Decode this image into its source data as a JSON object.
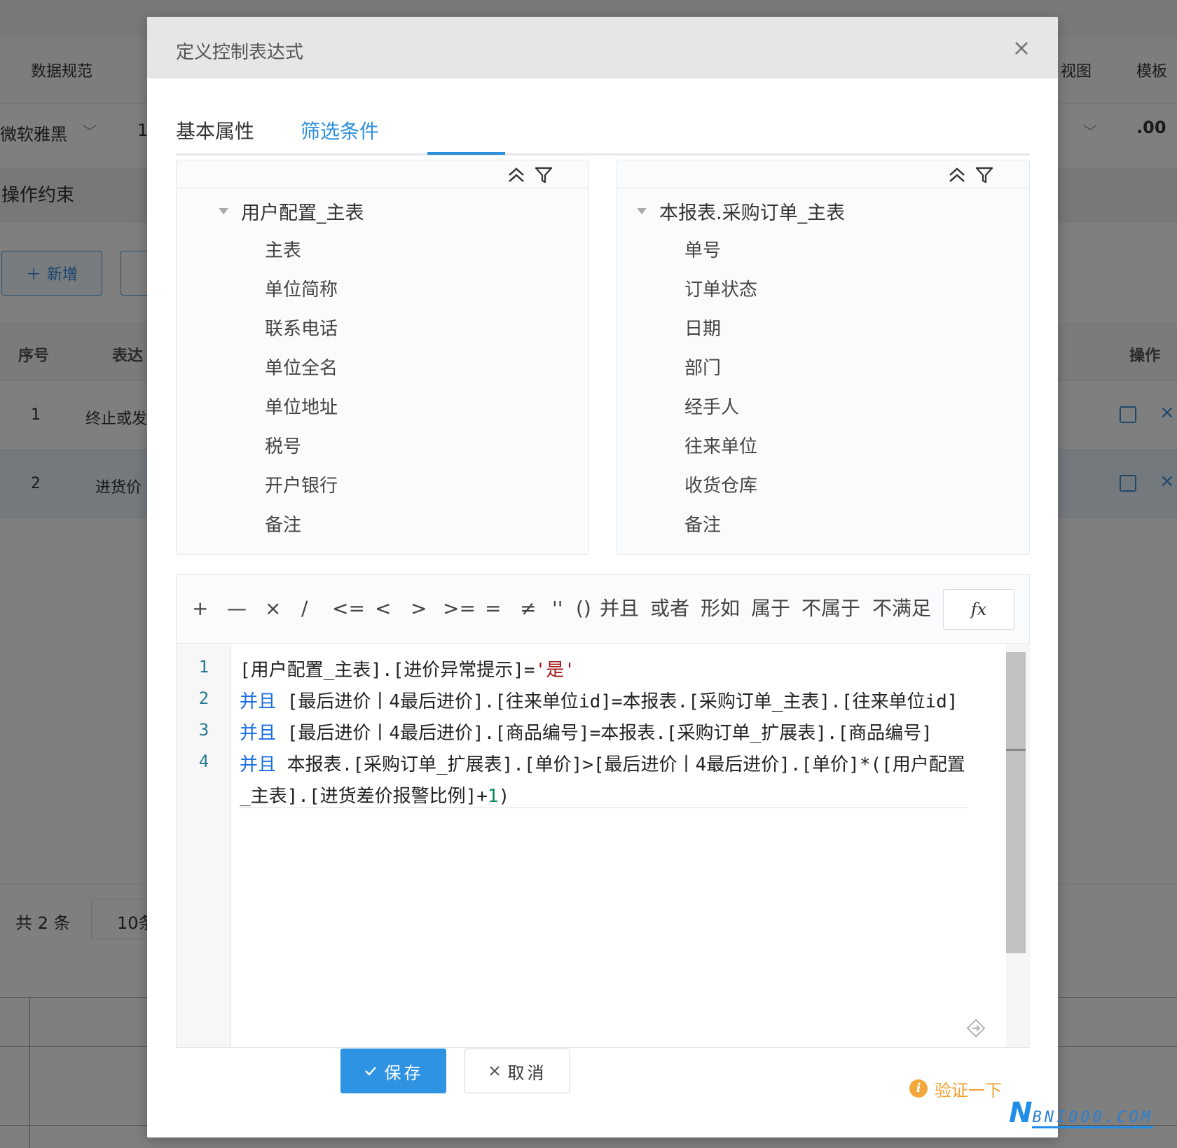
{
  "background": {
    "menu": [
      "数据规范",
      "视图",
      "模板"
    ],
    "font_name": "微软雅黑",
    "font_size": "1",
    "decimal_icon": ".00",
    "section_title": "操作约束",
    "add_button": "新增",
    "table_headers": [
      "序号",
      "表达",
      "操作"
    ],
    "rows": [
      {
        "index": "1",
        "expr": "终止或发"
      },
      {
        "index": "2",
        "expr": "进货价"
      }
    ],
    "total": "共 2 条",
    "page_size": "10条"
  },
  "dialog": {
    "title": "定义控制表达式",
    "tabs": [
      {
        "label": "基本属性",
        "active": false
      },
      {
        "label": "筛选条件",
        "active": true
      }
    ],
    "left_tree": {
      "root": "用户配置_主表",
      "items": [
        "主表",
        "单位简称",
        "联系电话",
        "单位全名",
        "单位地址",
        "税号",
        "开户银行",
        "备注"
      ]
    },
    "right_tree": {
      "root": "本报表.采购订单_主表",
      "items": [
        "单号",
        "订单状态",
        "日期",
        "部门",
        "经手人",
        "往来单位",
        "收货仓库",
        "备注"
      ]
    },
    "operators": [
      "+",
      "—",
      "×",
      "∕",
      "<=",
      "<",
      ">",
      ">=",
      "=",
      "≠",
      "''",
      "()",
      "并且",
      "或者",
      "形如",
      "属于",
      "不属于",
      "不满足"
    ],
    "fx_label": "fx",
    "code": {
      "line_numbers": [
        "1",
        "2",
        "3",
        "4"
      ],
      "lines": [
        {
          "kw": "",
          "text": "[用户配置_主表].[进价异常提示]=",
          "str": "'是'",
          "tail": ""
        },
        {
          "kw": "并且",
          "text": " [最后进价丨4最后进价].[往来单位id]=本报表.[采购订单_主表].[往来单位id]",
          "str": "",
          "tail": ""
        },
        {
          "kw": "并且",
          "text": " [最后进价丨4最后进价].[商品编号]=本报表.[采购订单_扩展表].[商品编号]",
          "str": "",
          "tail": ""
        },
        {
          "kw": "并且",
          "text": " 本报表.[采购订单_扩展表].[单价]>[最后进价丨4最后进价].[单价]*([用户配置",
          "str": "",
          "tail": ""
        },
        {
          "kw": "",
          "text": "_主表].[进货差价报警比例]+",
          "num": "1",
          "tail": ")"
        }
      ]
    },
    "save_label": "保存",
    "cancel_label": "取消",
    "verify_label": "验证一下"
  },
  "watermark": {
    "first": "N",
    "rest": "BNI000.COM"
  },
  "colors": {
    "primary": "#2f8fdc",
    "keyword": "#1a6fe0",
    "string": "#a31515",
    "number": "#098658",
    "warning": "#f0a030"
  }
}
